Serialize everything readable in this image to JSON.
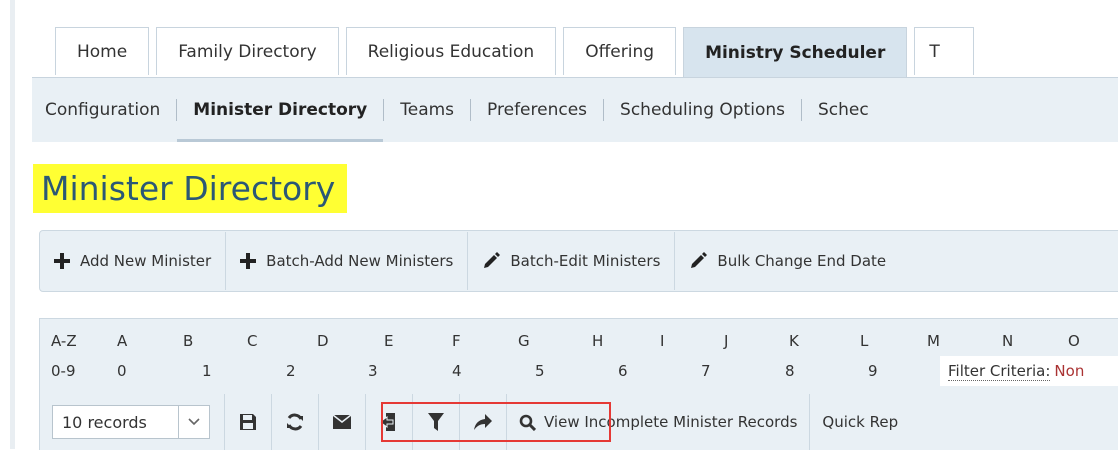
{
  "tabs": [
    {
      "label": "Home"
    },
    {
      "label": "Family Directory"
    },
    {
      "label": "Religious Education"
    },
    {
      "label": "Offering"
    },
    {
      "label": "Ministry Scheduler"
    },
    {
      "label": "T"
    }
  ],
  "subnav": [
    {
      "label": "Configuration"
    },
    {
      "label": "Minister Directory"
    },
    {
      "label": "Teams"
    },
    {
      "label": "Preferences"
    },
    {
      "label": "Scheduling Options"
    },
    {
      "label": "Schec"
    }
  ],
  "page_title": "Minister Directory",
  "actions": [
    {
      "label": "Add New Minister",
      "icon": "plus-icon"
    },
    {
      "label": "Batch-Add New Ministers",
      "icon": "plus-icon"
    },
    {
      "label": "Batch-Edit Ministers",
      "icon": "pencil-icon"
    },
    {
      "label": "Bulk Change End Date",
      "icon": "pencil-icon"
    }
  ],
  "alpha_row": [
    "A-Z",
    "A",
    "B",
    "C",
    "D",
    "E",
    "F",
    "G",
    "H",
    "I",
    "J",
    "K",
    "L",
    "M",
    "N",
    "O"
  ],
  "num_row": [
    "0-9",
    "0",
    "1",
    "2",
    "3",
    "4",
    "5",
    "6",
    "7",
    "8",
    "9"
  ],
  "filter": {
    "label": "Filter Criteria:",
    "value": "Non"
  },
  "toolbar": {
    "records_select": "10 records",
    "view_incomplete": "View Incomplete Minister Records",
    "quick_report": "Quick Rep"
  },
  "colors": {
    "accent": "#2b5876",
    "highlight": "#ffff33",
    "red_box": "#e53935",
    "toolbar_bg": "#e9f0f5"
  }
}
